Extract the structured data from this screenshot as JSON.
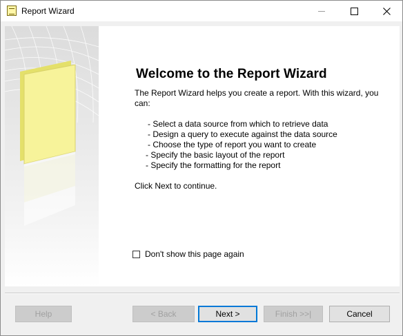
{
  "window": {
    "title": "Report Wizard",
    "icon": "report-icon"
  },
  "page": {
    "heading": "Welcome to the Report Wizard",
    "intro": "The Report Wizard helps you create a report. With this wizard, you can:",
    "bullets": [
      "- Select a data source from which to retrieve data",
      "- Design a query to execute against the data source",
      "- Choose the type of report you want to create",
      "- Specify the basic layout of the report",
      "- Specify the formatting for the report"
    ],
    "continue_text": "Click Next to continue.",
    "dont_show_label": "Don't show this page again",
    "dont_show_checked": false
  },
  "buttons": {
    "help": "Help",
    "back": "< Back",
    "next": "Next >",
    "finish": "Finish >>|",
    "cancel": "Cancel"
  }
}
